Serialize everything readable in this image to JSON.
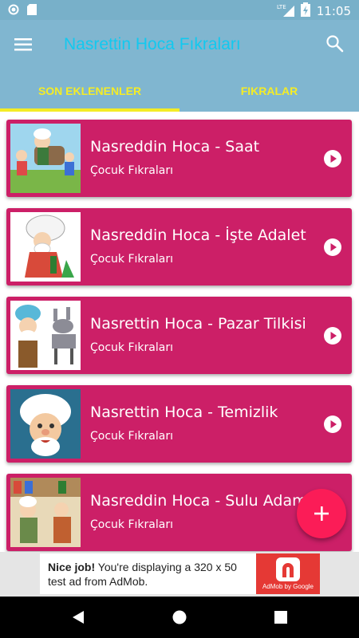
{
  "status_bar": {
    "time": "11:05",
    "network": "LTE"
  },
  "app_bar": {
    "title": "Nasrettin Hoca Fıkraları",
    "menu_icon": "hamburger-menu-icon",
    "search_icon": "search-icon"
  },
  "tabs": [
    {
      "label": "SON EKLENENLER",
      "selected": true
    },
    {
      "label": "FIKRALAR",
      "selected": false
    }
  ],
  "colors": {
    "app_bar": "#80b6d0",
    "title": "#12c9ef",
    "tab_text": "#f4ec26",
    "card": "#cc1f67",
    "fab": "#fb1c57"
  },
  "stories": [
    {
      "title": "Nasreddin Hoca - Saat",
      "category": "Çocuk Fıkraları"
    },
    {
      "title": "Nasreddin Hoca - İşte Adalet",
      "category": "Çocuk Fıkraları"
    },
    {
      "title": "Nasrettin Hoca - Pazar Tilkisi",
      "category": "Çocuk Fıkraları"
    },
    {
      "title": "Nasrettin Hoca - Temizlik",
      "category": "Çocuk Fıkraları"
    },
    {
      "title": "Nasreddin Hoca - Sulu Adam",
      "category": "Çocuk Fıkraları"
    }
  ],
  "fab": {
    "label": "+"
  },
  "ad": {
    "headline": "Nice job!",
    "body": "You're displaying a 320 x 50 test ad from AdMob.",
    "logo_text": "AdMob by Google"
  }
}
